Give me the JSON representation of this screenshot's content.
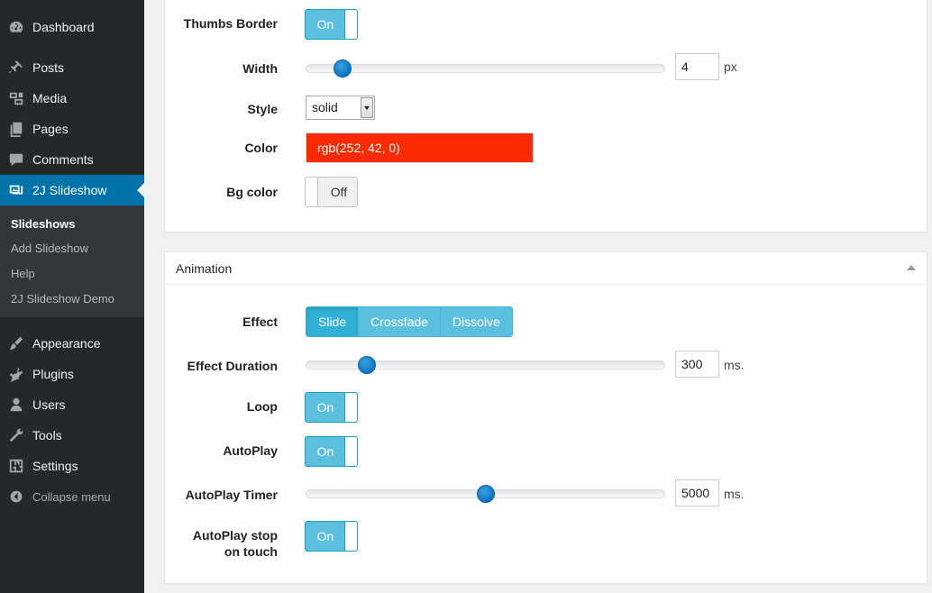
{
  "sidebar": {
    "items": [
      {
        "label": "Dashboard",
        "icon": "dashboard-icon"
      },
      {
        "label": "Posts",
        "icon": "pin-icon"
      },
      {
        "label": "Media",
        "icon": "media-icon"
      },
      {
        "label": "Pages",
        "icon": "pages-icon"
      },
      {
        "label": "Comments",
        "icon": "comment-icon"
      },
      {
        "label": "2J Slideshow",
        "icon": "slideshow-icon"
      },
      {
        "label": "Appearance",
        "icon": "brush-icon"
      },
      {
        "label": "Plugins",
        "icon": "plugin-icon"
      },
      {
        "label": "Users",
        "icon": "user-icon"
      },
      {
        "label": "Tools",
        "icon": "wrench-icon"
      },
      {
        "label": "Settings",
        "icon": "settings-icon"
      }
    ],
    "submenu": [
      "Slideshows",
      "Add Slideshow",
      "Help",
      "2J Slideshow Demo"
    ],
    "collapse_label": "Collapse menu"
  },
  "thumbs": {
    "border_label": "Thumbs Border",
    "border_state": "On",
    "width_label": "Width",
    "width_value": "4",
    "width_unit": "px",
    "width_fraction": 0.08,
    "style_label": "Style",
    "style_value": "solid",
    "color_label": "Color",
    "color_value": "rgb(252, 42, 0)",
    "color_hex": "#fc2a00",
    "bg_label": "Bg color",
    "bg_state": "Off"
  },
  "animation": {
    "title": "Animation",
    "effect_label": "Effect",
    "effects": [
      "Slide",
      "Crossfade",
      "Dissolve"
    ],
    "effect_selected": "Slide",
    "duration_label": "Effect Duration",
    "duration_value": "300",
    "duration_unit": "ms.",
    "duration_fraction": 0.15,
    "loop_label": "Loop",
    "loop_state": "On",
    "autoplay_label": "AutoPlay",
    "autoplay_state": "On",
    "timer_label": "AutoPlay Timer",
    "timer_value": "5000",
    "timer_unit": "ms.",
    "timer_fraction": 0.5,
    "stop_label_line1": "AutoPlay stop",
    "stop_label_line2": "on touch",
    "stop_state": "On"
  },
  "colors": {
    "sidebar_bg": "#23282d",
    "sidebar_active": "#0073aa",
    "switch_on": "#5bc0de",
    "slider_thumb": "#0a73c2"
  }
}
